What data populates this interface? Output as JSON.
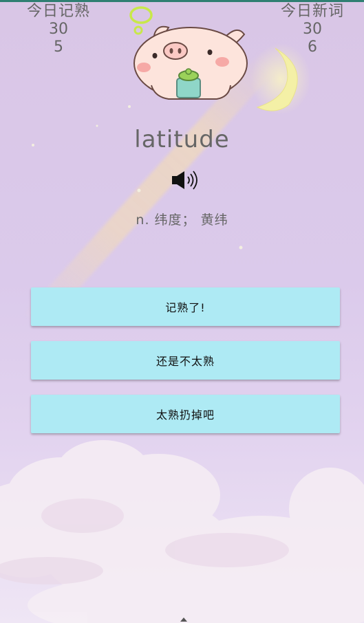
{
  "stats": {
    "left": {
      "title": "今日记熟",
      "total": "30",
      "count": "5"
    },
    "right": {
      "title": "今日新词",
      "total": "30",
      "count": "6"
    }
  },
  "card": {
    "word": "latitude",
    "meaning": "n. 纬度； 黄纬"
  },
  "buttons": {
    "remembered": "记熟了!",
    "not_familiar": "还是不太熟",
    "too_familiar": "太熟扔掉吧"
  },
  "icons": [
    "pig-illustration",
    "moon-icon",
    "speaker-icon"
  ],
  "colors": {
    "button_bg": "#aeeaf4",
    "text": "#666666"
  }
}
